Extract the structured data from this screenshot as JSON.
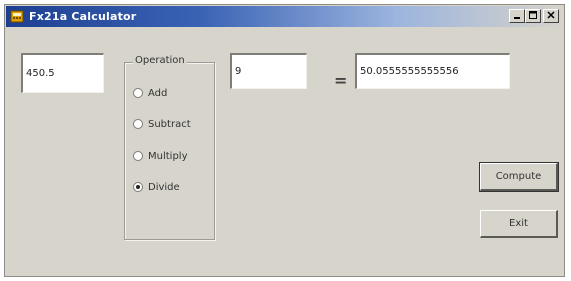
{
  "window": {
    "title": "Fx21a Calculator",
    "controls": {
      "minimize_icon": "minimize-icon",
      "maximize_icon": "maximize-icon",
      "close_icon": "close-icon"
    }
  },
  "calculator": {
    "operand1_value": "450.5",
    "operation": {
      "group_label": "Operation",
      "options": [
        {
          "label": "Add",
          "checked": false
        },
        {
          "label": "Subtract",
          "checked": false
        },
        {
          "label": "Multiply",
          "checked": false
        },
        {
          "label": "Divide",
          "checked": true
        }
      ]
    },
    "operand2_value": "9",
    "equals_sign": "=",
    "result_value": "50.0555555555556"
  },
  "buttons": {
    "compute_label": "Compute",
    "exit_label": "Exit"
  },
  "colors": {
    "titlebar_start": "#1e3f91",
    "window_background": "#d7d4cb"
  }
}
